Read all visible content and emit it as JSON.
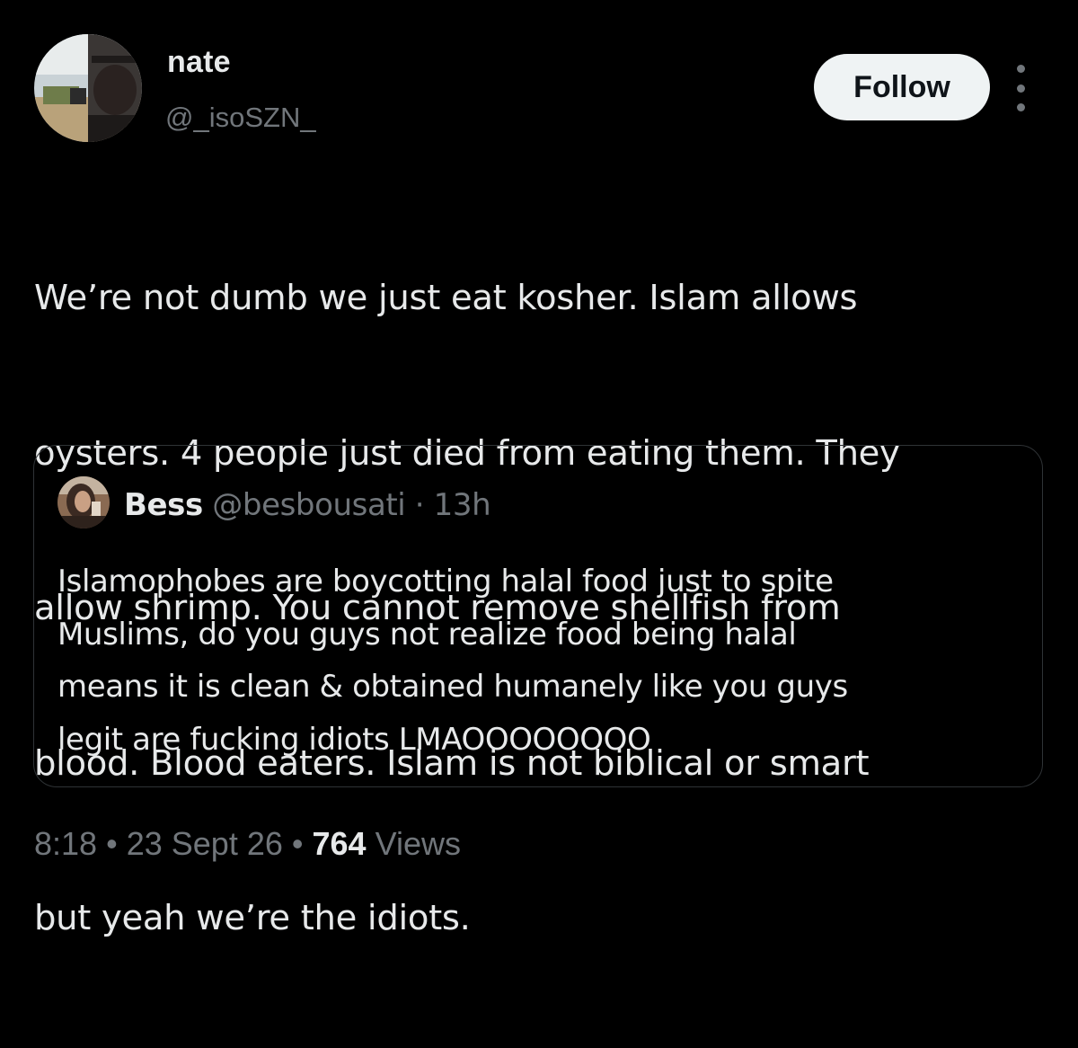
{
  "author": {
    "name": "nate",
    "handle": "@_isoSZN_"
  },
  "follow_label": "Follow",
  "more_icon": "more-vertical-icon",
  "tweet": {
    "lines": [
      "We’re not dumb we just eat kosher. Islam allows",
      "oysters. 4 people just died from eating them. They",
      "allow shrimp. You cannot remove shellfish from",
      "blood. Blood eaters. Islam is not biblical or smart",
      "but yeah we’re the idiots."
    ]
  },
  "quote": {
    "name": "Bess",
    "handle": "@besbousati",
    "separator": "·",
    "time": "13h",
    "lines": [
      "Islamophobes are boycotting halal food just to spite",
      "Muslims, do you guys not realize food being halal",
      "means it is clean & obtained humanely like you guys",
      "legit are fucking idiots LMAOOOOOOOO"
    ]
  },
  "meta": {
    "time": "8:18",
    "dot": "•",
    "date": "23 Sept 26",
    "views_count": "764",
    "views_label": "Views"
  },
  "colors": {
    "background": "#000000",
    "text_primary": "#e7e9ea",
    "text_secondary": "#71767b",
    "border": "#2f3336",
    "follow_bg": "#eff3f4",
    "follow_text": "#0f1419"
  }
}
